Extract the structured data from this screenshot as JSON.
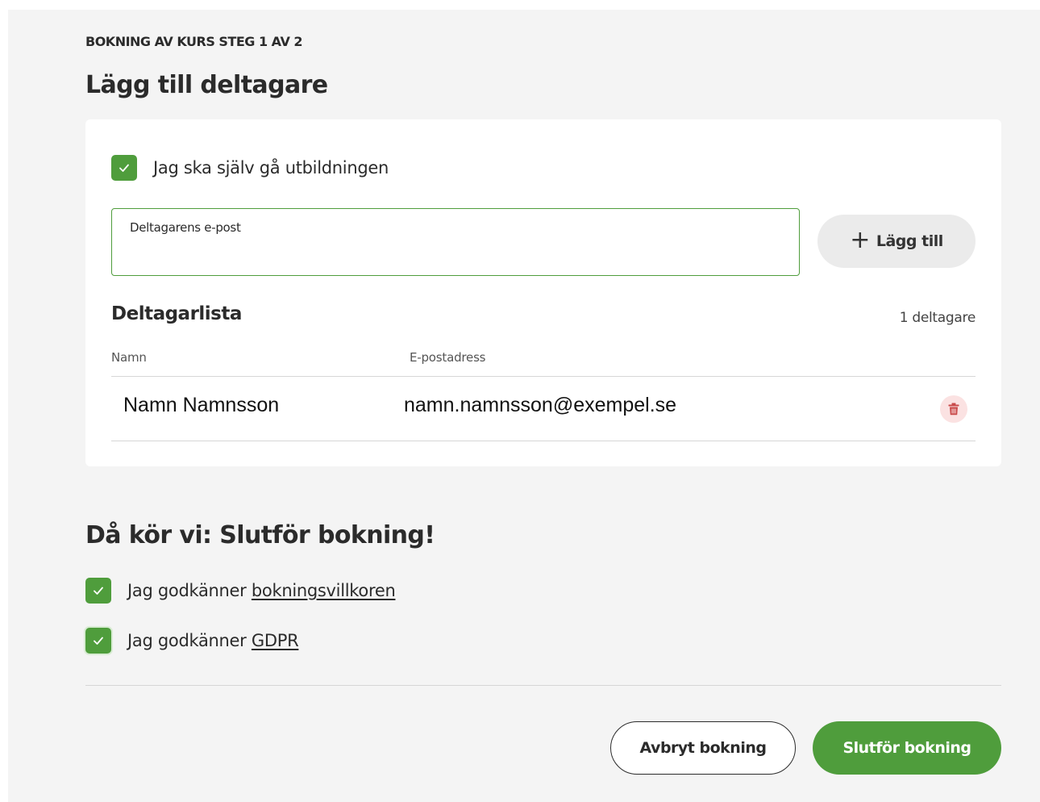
{
  "header": {
    "step_label": "BOKNING AV KURS STEG 1 AV 2",
    "title": "Lägg till deltagare"
  },
  "participants": {
    "self_checkbox_label": "Jag ska själv gå utbildningen",
    "self_checked": true,
    "email_label": "Deltagarens e-post",
    "email_value": "",
    "add_button_label": "Lägg till",
    "list_title": "Deltagarlista",
    "count_text": "1 deltagare",
    "columns": [
      "Namn",
      "E-postadress"
    ],
    "rows": [
      {
        "name": "Namn Namnsson",
        "email": "namn.namnsson@exempel.se"
      }
    ]
  },
  "finish": {
    "title": "Då kör vi: Slutför bokning!",
    "terms_prefix": "Jag godkänner ",
    "terms_link": "bokningsvillkoren",
    "terms_checked": true,
    "gdpr_prefix": "Jag godkänner ",
    "gdpr_link": "GDPR",
    "gdpr_checked": true,
    "cancel_label": "Avbryt bokning",
    "submit_label": "Slutför bokning"
  },
  "colors": {
    "accent": "#4f9d3c",
    "delete_bg": "#fbe2e2",
    "delete_icon": "#c94a4a"
  },
  "icons": {
    "checkbox": "check-icon",
    "add": "plus-icon",
    "delete": "trash-icon"
  }
}
